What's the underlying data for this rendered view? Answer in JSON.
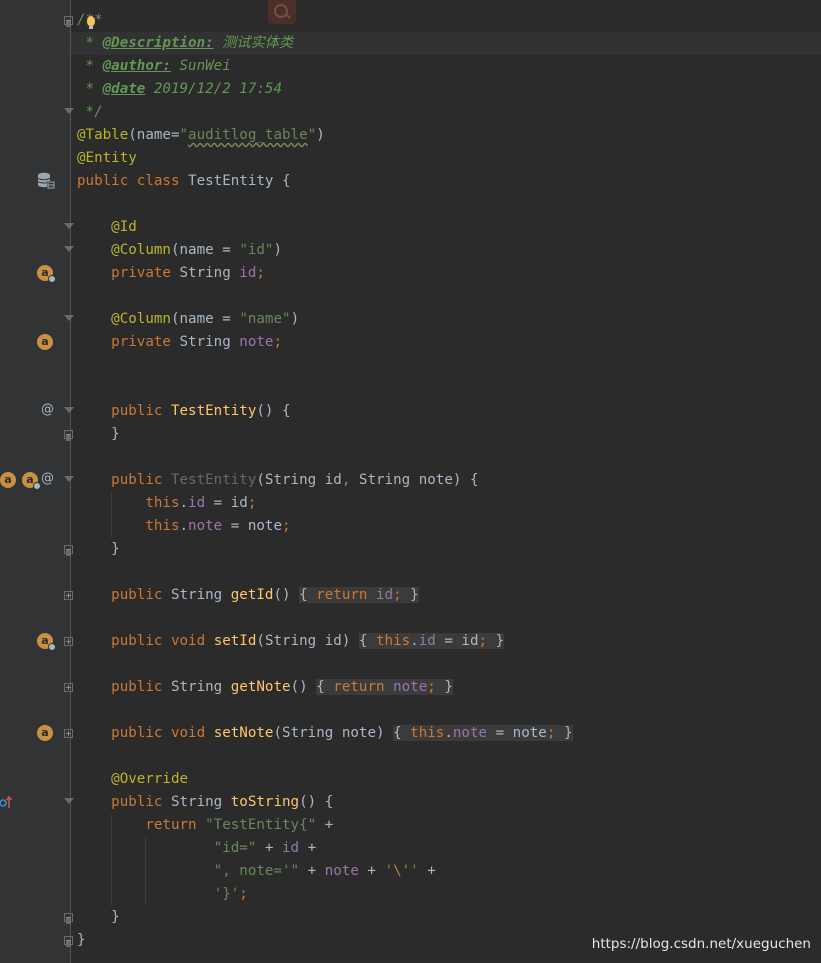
{
  "editor": {
    "lines": [
      [
        {
          "t": "/**",
          "c": "#629755"
        }
      ],
      [
        {
          "t": " * ",
          "c": "#629755"
        },
        {
          "t": "@Description:",
          "c": "#629755",
          "b": 1,
          "u": 1
        },
        {
          "t": " 测试实体类",
          "c": "#629755"
        }
      ],
      [
        {
          "t": " * ",
          "c": "#629755"
        },
        {
          "t": "@author:",
          "c": "#629755",
          "b": 1,
          "u": 1
        },
        {
          "t": " SunWei",
          "c": "#629755"
        }
      ],
      [
        {
          "t": " * ",
          "c": "#629755"
        },
        {
          "t": "@date",
          "c": "#629755",
          "b": 1,
          "u": 1,
          "n": 1
        },
        {
          "t": " 2019/12/2 17:54",
          "c": "#629755"
        }
      ],
      [
        {
          "t": " */",
          "c": "#629755"
        }
      ],
      [
        {
          "t": "@Table",
          "c": "#bbb529"
        },
        {
          "t": "(name=",
          "c": "#a9b7c6"
        },
        {
          "t": "\"",
          "c": "#6a8759"
        },
        {
          "t": "auditlog_table",
          "c": "#6a8759",
          "sq": 1
        },
        {
          "t": "\"",
          "c": "#6a8759"
        },
        {
          "t": ")",
          "c": "#a9b7c6"
        }
      ],
      [
        {
          "t": "@Entity",
          "c": "#bbb529"
        }
      ],
      [
        {
          "t": "public class ",
          "c": "#cc7832"
        },
        {
          "t": "TestEntity {",
          "c": "#a9b7c6"
        }
      ],
      [],
      [
        {
          "t": "    @Id",
          "c": "#bbb529"
        }
      ],
      [
        {
          "t": "    @Column",
          "c": "#bbb529"
        },
        {
          "t": "(name = ",
          "c": "#a9b7c6"
        },
        {
          "t": "\"id\"",
          "c": "#6a8759"
        },
        {
          "t": ")",
          "c": "#a9b7c6"
        }
      ],
      [
        {
          "t": "    private ",
          "c": "#cc7832"
        },
        {
          "t": "String ",
          "c": "#a9b7c6"
        },
        {
          "t": "id",
          "c": "#9876aa"
        },
        {
          "t": ";",
          "c": "#cc7832"
        }
      ],
      [],
      [
        {
          "t": "    @Column",
          "c": "#bbb529"
        },
        {
          "t": "(name = ",
          "c": "#a9b7c6"
        },
        {
          "t": "\"name\"",
          "c": "#6a8759"
        },
        {
          "t": ")",
          "c": "#a9b7c6"
        }
      ],
      [
        {
          "t": "    private ",
          "c": "#cc7832"
        },
        {
          "t": "String ",
          "c": "#a9b7c6"
        },
        {
          "t": "note",
          "c": "#9876aa"
        },
        {
          "t": ";",
          "c": "#cc7832"
        }
      ],
      [],
      [],
      [
        {
          "t": "    public ",
          "c": "#cc7832"
        },
        {
          "t": "TestEntity",
          "c": "#ffc66d"
        },
        {
          "t": "() {",
          "c": "#a9b7c6"
        }
      ],
      [
        {
          "t": "    }",
          "c": "#a9b7c6"
        }
      ],
      [],
      [
        {
          "t": "    public ",
          "c": "#cc7832"
        },
        {
          "t": "TestEntity",
          "c": "#5c6a78"
        },
        {
          "t": "(String id",
          "c": "#a9b7c6"
        },
        {
          "t": ", ",
          "c": "#cc7832"
        },
        {
          "t": "String note) {",
          "c": "#a9b7c6"
        }
      ],
      [
        {
          "t": "        this",
          "c": "#cc7832"
        },
        {
          "t": ".",
          "c": "#a9b7c6"
        },
        {
          "t": "id",
          "c": "#9876aa"
        },
        {
          "t": " = id",
          "c": "#a9b7c6"
        },
        {
          "t": ";",
          "c": "#cc7832"
        }
      ],
      [
        {
          "t": "        this",
          "c": "#cc7832"
        },
        {
          "t": ".",
          "c": "#a9b7c6"
        },
        {
          "t": "note",
          "c": "#9876aa"
        },
        {
          "t": " = note",
          "c": "#a9b7c6"
        },
        {
          "t": ";",
          "c": "#cc7832"
        }
      ],
      [
        {
          "t": "    }",
          "c": "#a9b7c6"
        }
      ],
      [],
      [
        {
          "t": "    public ",
          "c": "#cc7832"
        },
        {
          "t": "String ",
          "c": "#a9b7c6"
        },
        {
          "t": "getId",
          "c": "#ffc66d"
        },
        {
          "t": "() ",
          "c": "#a9b7c6"
        },
        {
          "t": "{ ",
          "c": "#a9b7c6",
          "bg": "#3b3b3b"
        },
        {
          "t": "return ",
          "c": "#cc7832",
          "bg": "#3b3b3b"
        },
        {
          "t": "id",
          "c": "#9876aa",
          "bg": "#3b3b3b"
        },
        {
          "t": ";",
          "c": "#cc7832",
          "bg": "#3b3b3b"
        },
        {
          "t": " }",
          "c": "#a9b7c6",
          "bg": "#3b3b3b"
        }
      ],
      [],
      [
        {
          "t": "    public ",
          "c": "#cc7832"
        },
        {
          "t": "void ",
          "c": "#cc7832"
        },
        {
          "t": "setId",
          "c": "#ffc66d"
        },
        {
          "t": "(String id) ",
          "c": "#a9b7c6"
        },
        {
          "t": "{ ",
          "c": "#a9b7c6",
          "bg": "#3b3b3b"
        },
        {
          "t": "this",
          "c": "#cc7832",
          "bg": "#3b3b3b"
        },
        {
          "t": ".",
          "c": "#a9b7c6",
          "bg": "#3b3b3b"
        },
        {
          "t": "id",
          "c": "#9876aa",
          "bg": "#3b3b3b"
        },
        {
          "t": " = id",
          "c": "#a9b7c6",
          "bg": "#3b3b3b"
        },
        {
          "t": ";",
          "c": "#cc7832",
          "bg": "#3b3b3b"
        },
        {
          "t": " }",
          "c": "#a9b7c6",
          "bg": "#3b3b3b"
        }
      ],
      [],
      [
        {
          "t": "    public ",
          "c": "#cc7832"
        },
        {
          "t": "String ",
          "c": "#a9b7c6"
        },
        {
          "t": "getNote",
          "c": "#ffc66d"
        },
        {
          "t": "() ",
          "c": "#a9b7c6"
        },
        {
          "t": "{ ",
          "c": "#a9b7c6",
          "bg": "#3b3b3b"
        },
        {
          "t": "return ",
          "c": "#cc7832",
          "bg": "#3b3b3b"
        },
        {
          "t": "note",
          "c": "#9876aa",
          "bg": "#3b3b3b"
        },
        {
          "t": ";",
          "c": "#cc7832",
          "bg": "#3b3b3b"
        },
        {
          "t": " }",
          "c": "#a9b7c6",
          "bg": "#3b3b3b"
        }
      ],
      [],
      [
        {
          "t": "    public ",
          "c": "#cc7832"
        },
        {
          "t": "void ",
          "c": "#cc7832"
        },
        {
          "t": "setNote",
          "c": "#ffc66d"
        },
        {
          "t": "(String note) ",
          "c": "#a9b7c6"
        },
        {
          "t": "{ ",
          "c": "#a9b7c6",
          "bg": "#3b3b3b"
        },
        {
          "t": "this",
          "c": "#cc7832",
          "bg": "#3b3b3b"
        },
        {
          "t": ".",
          "c": "#a9b7c6",
          "bg": "#3b3b3b"
        },
        {
          "t": "note",
          "c": "#9876aa",
          "bg": "#3b3b3b"
        },
        {
          "t": " = note",
          "c": "#a9b7c6",
          "bg": "#3b3b3b"
        },
        {
          "t": ";",
          "c": "#cc7832",
          "bg": "#3b3b3b"
        },
        {
          "t": " }",
          "c": "#a9b7c6",
          "bg": "#3b3b3b"
        }
      ],
      [],
      [
        {
          "t": "    @Override",
          "c": "#bbb529"
        }
      ],
      [
        {
          "t": "    public ",
          "c": "#cc7832"
        },
        {
          "t": "String ",
          "c": "#a9b7c6"
        },
        {
          "t": "toString",
          "c": "#ffc66d"
        },
        {
          "t": "() {",
          "c": "#a9b7c6"
        }
      ],
      [
        {
          "t": "        return ",
          "c": "#cc7832"
        },
        {
          "t": "\"TestEntity{\"",
          "c": "#6a8759"
        },
        {
          "t": " +",
          "c": "#a9b7c6"
        }
      ],
      [
        {
          "t": "                ",
          "c": "#a9b7c6"
        },
        {
          "t": "\"id=\"",
          "c": "#6a8759"
        },
        {
          "t": " + ",
          "c": "#a9b7c6"
        },
        {
          "t": "id",
          "c": "#9876aa"
        },
        {
          "t": " +",
          "c": "#a9b7c6"
        }
      ],
      [
        {
          "t": "                ",
          "c": "#a9b7c6"
        },
        {
          "t": "\", note='\"",
          "c": "#6a8759"
        },
        {
          "t": " + ",
          "c": "#a9b7c6"
        },
        {
          "t": "note",
          "c": "#9876aa"
        },
        {
          "t": " + ",
          "c": "#a9b7c6"
        },
        {
          "t": "'",
          "c": "#6a8759"
        },
        {
          "t": "\\'",
          "c": "#cc7832"
        },
        {
          "t": "'",
          "c": "#6a8759"
        },
        {
          "t": " +",
          "c": "#a9b7c6"
        }
      ],
      [
        {
          "t": "                ",
          "c": "#a9b7c6"
        },
        {
          "t": "'}'",
          "c": "#6a8759"
        },
        {
          "t": ";",
          "c": "#cc7832"
        }
      ],
      [
        {
          "t": "    }",
          "c": "#a9b7c6"
        }
      ],
      [
        {
          "t": "}",
          "c": "#a9b7c6"
        }
      ]
    ]
  },
  "gutter": {
    "markers": [
      {
        "line": 7,
        "kind": "database-icon"
      },
      {
        "line": 11,
        "kind": "field-key-icon",
        "label": "a"
      },
      {
        "line": 14,
        "kind": "field-icon",
        "label": "a"
      },
      {
        "line": 17,
        "kind": "annotation-icon",
        "label": "@"
      },
      {
        "line": 20,
        "kind": "constructor-params-icon",
        "label": "a"
      },
      {
        "line": 27,
        "kind": "field-key-icon",
        "label": "a"
      },
      {
        "line": 31,
        "kind": "field-icon",
        "label": "a"
      },
      {
        "line": 34,
        "kind": "override-icon"
      }
    ]
  },
  "watermark": "https://blog.csdn.net/xueguchen"
}
